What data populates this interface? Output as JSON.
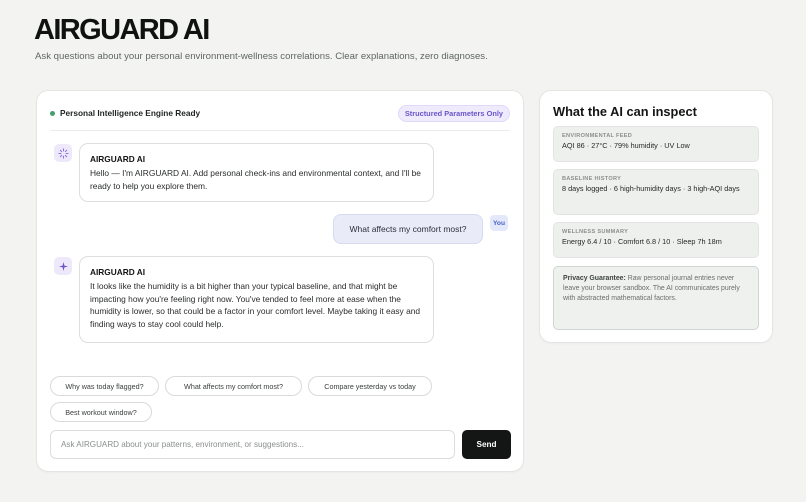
{
  "app": {
    "title": "AIRGUARD AI",
    "subtitle": "Ask questions about your personal environment-wellness correlations. Clear explanations, zero diagnoses."
  },
  "chat": {
    "status_text": "Personal Intelligence Engine Ready",
    "status_badge": "Structured Parameters Only",
    "messages": [
      {
        "role": "ai",
        "sender": "AIRGUARD AI",
        "text": "Hello — I'm AIRGUARD AI. Add personal check-ins and environmental context, and I'll be ready to help you explore them."
      },
      {
        "role": "user",
        "badge": "You",
        "text": "What affects my comfort most?"
      },
      {
        "role": "ai",
        "sender": "AIRGUARD AI",
        "text": "It looks like the humidity is a bit higher than your typical baseline, and that might be impacting how you're feeling right now. You've tended to feel more at ease when the humidity is lower, so that could be a factor in your comfort level. Maybe taking it easy and finding ways to stay cool could help."
      }
    ],
    "suggestions": [
      "Why was today flagged?",
      "What affects my comfort most?",
      "Compare yesterday vs today",
      "Best workout window?"
    ],
    "input_placeholder": "Ask AIRGUARD about your patterns, environment, or suggestions...",
    "send_label": "Send"
  },
  "inspect": {
    "title": "What the AI can inspect",
    "sections": [
      {
        "label": "ENVIRONMENTAL FEED",
        "value": "AQI 86 · 27°C · 79% humidity · UV Low"
      },
      {
        "label": "BASELINE HISTORY",
        "value": "8 days logged · 6 high-humidity days · 3 high-AQI days"
      },
      {
        "label": "WELLNESS SUMMARY",
        "value": "Energy 6.4 / 10 · Comfort 6.8 / 10 · Sleep 7h 18m"
      }
    ],
    "privacy_title": "Privacy Guarantee:",
    "privacy_text": "Raw personal journal entries never leave your browser sandbox. The AI communicates purely with abstracted mathematical factors."
  },
  "colors": {
    "accent": "#6d55c8",
    "status": "#45a06a",
    "send_button": "#141615"
  },
  "icons": {
    "ai_loading": "sparkle-spinner-icon",
    "ai_sparkle": "sparkle-icon"
  }
}
